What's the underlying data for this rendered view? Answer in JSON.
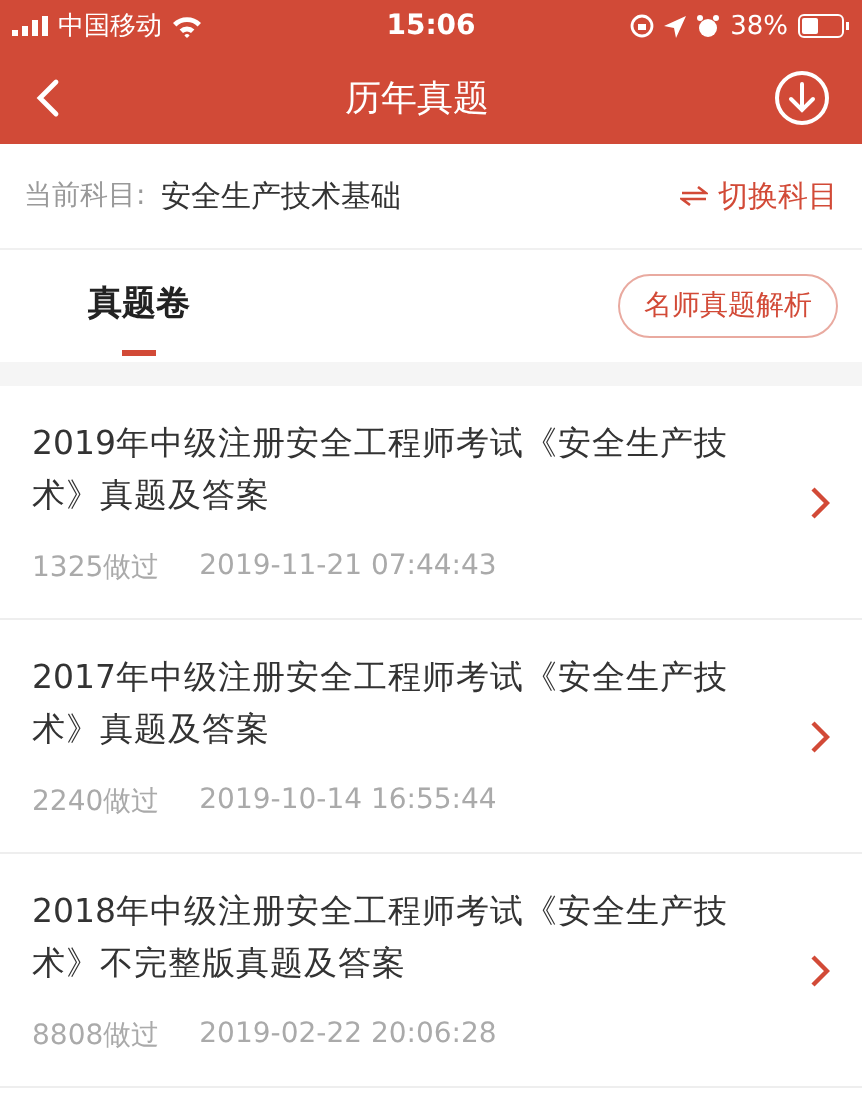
{
  "status_bar": {
    "carrier": "中国移动",
    "time": "15:06",
    "battery": "38%"
  },
  "nav": {
    "title": "历年真题"
  },
  "subject": {
    "label": "当前科目:",
    "value": "安全生产技术基础",
    "switch": "切换科目"
  },
  "tabs": [
    {
      "label": "真题卷",
      "selected": true
    }
  ],
  "tab_button": "名师真题解析",
  "papers": [
    {
      "title": "2019年中级注册安全工程师考试《安全生产技术》真题及答案",
      "count": "1325做过",
      "date": "2019-11-21 07:44:43"
    },
    {
      "title": "2017年中级注册安全工程师考试《安全生产技术》真题及答案",
      "count": "2240做过",
      "date": "2019-10-14 16:55:44"
    },
    {
      "title": "2018年中级注册安全工程师考试《安全生产技术》不完整版真题及答案",
      "count": "8808做过",
      "date": "2019-02-22 20:06:28"
    }
  ]
}
